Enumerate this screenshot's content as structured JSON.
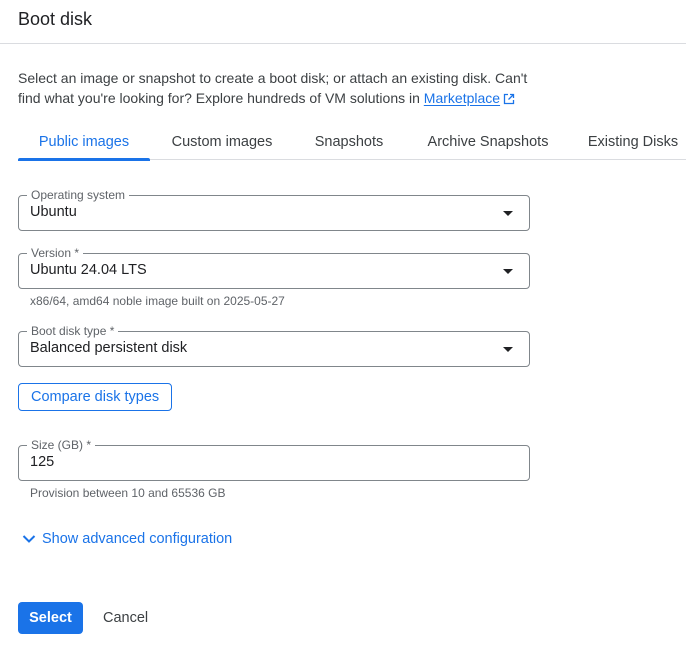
{
  "header": {
    "title": "Boot disk"
  },
  "intro": {
    "text": "Select an image or snapshot to create a boot disk; or attach an existing disk. Can't find what you're looking for? Explore hundreds of VM solutions in ",
    "link": "Marketplace",
    "link_icon": "open-in-new-icon"
  },
  "tabs": [
    {
      "label": "Public images",
      "active": true
    },
    {
      "label": "Custom images",
      "active": false
    },
    {
      "label": "Snapshots",
      "active": false
    },
    {
      "label": "Archive Snapshots",
      "active": false
    },
    {
      "label": "Existing Disks",
      "active": false
    }
  ],
  "fields": {
    "os": {
      "label": "Operating system",
      "value": "Ubuntu"
    },
    "version": {
      "label": "Version *",
      "value": "Ubuntu 24.04 LTS",
      "helper": "x86/64, amd64 noble image built on 2025-05-27"
    },
    "disk_type": {
      "label": "Boot disk type *",
      "value": "Balanced persistent disk"
    },
    "size": {
      "label": "Size (GB) *",
      "value": "125",
      "helper": "Provision between 10 and 65536 GB"
    }
  },
  "buttons": {
    "compare": "Compare disk types",
    "advanced": "Show advanced configuration",
    "select": "Select",
    "cancel": "Cancel"
  },
  "colors": {
    "accent": "#1a73e8",
    "border": "#80868b",
    "divider": "#dadce0"
  }
}
